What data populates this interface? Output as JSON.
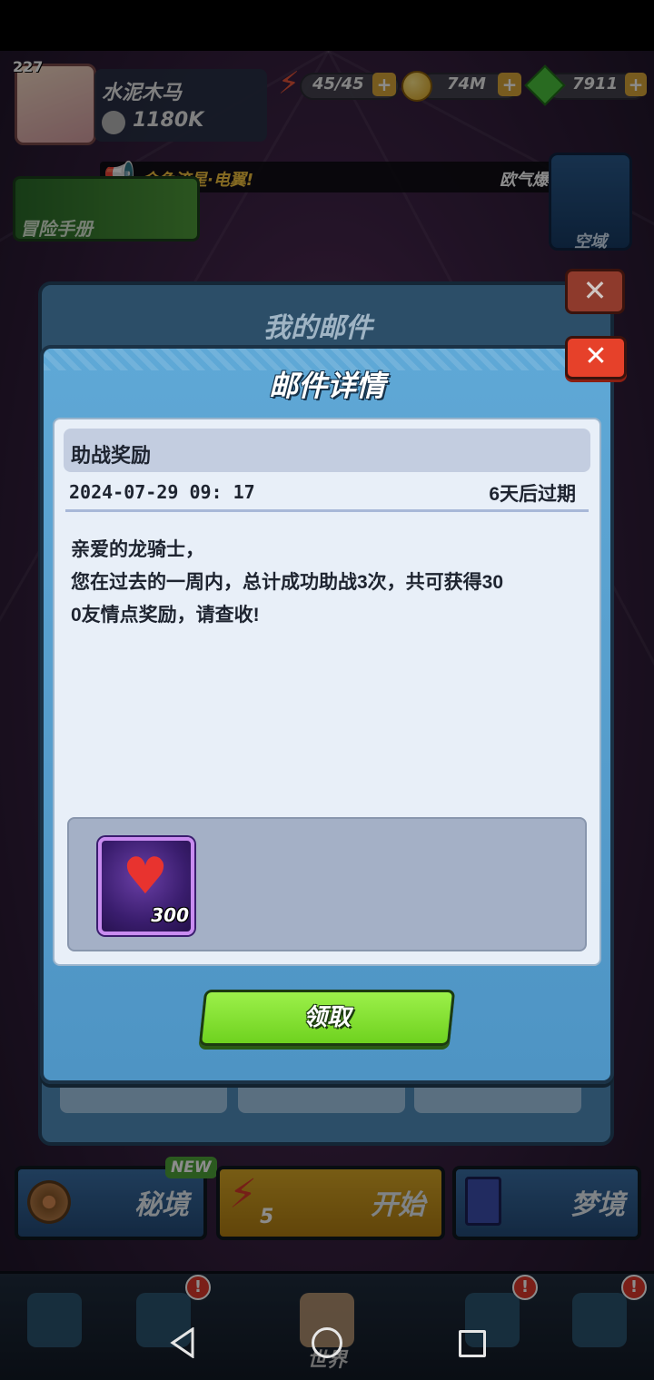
{
  "player": {
    "level": "227",
    "name": "水泥木马",
    "power": "1180K"
  },
  "resources": {
    "energy": "45/45",
    "coins": "74M",
    "gems": "7911"
  },
  "marquee": {
    "text": "金色流星·电翼!",
    "right_text": "欧气爆"
  },
  "shortcuts": {
    "adventure_handbook": "冒险手册",
    "airspace": "空域"
  },
  "mail_window": {
    "title": "我的邮件"
  },
  "mail_detail": {
    "title": "邮件详情",
    "close_symbol": "✕",
    "subject": "助战奖励",
    "date": "2024-07-29 09: 17",
    "expires": "6天后过期",
    "body_lines": [
      "亲爱的龙骑士，",
      "您在过去的一周内，总计成功助战3次，共可获得30",
      "0友情点奖励，请查收!"
    ],
    "attachments": [
      {
        "icon": "heart-icon",
        "quantity": "300"
      }
    ],
    "claim_label": "领取"
  },
  "actions": {
    "secret_realm": "秘境",
    "new_badge": "NEW",
    "start": "开始",
    "start_energy_cost": "5",
    "dream_realm": "梦境"
  },
  "nav": {
    "world": "世界",
    "alert_symbol": "!"
  },
  "colors": {
    "dialog_blue": "#5fa8d6",
    "claim_green": "#8ee63a",
    "close_red": "#e6412a",
    "reward_purple": "#4a2a8a"
  }
}
